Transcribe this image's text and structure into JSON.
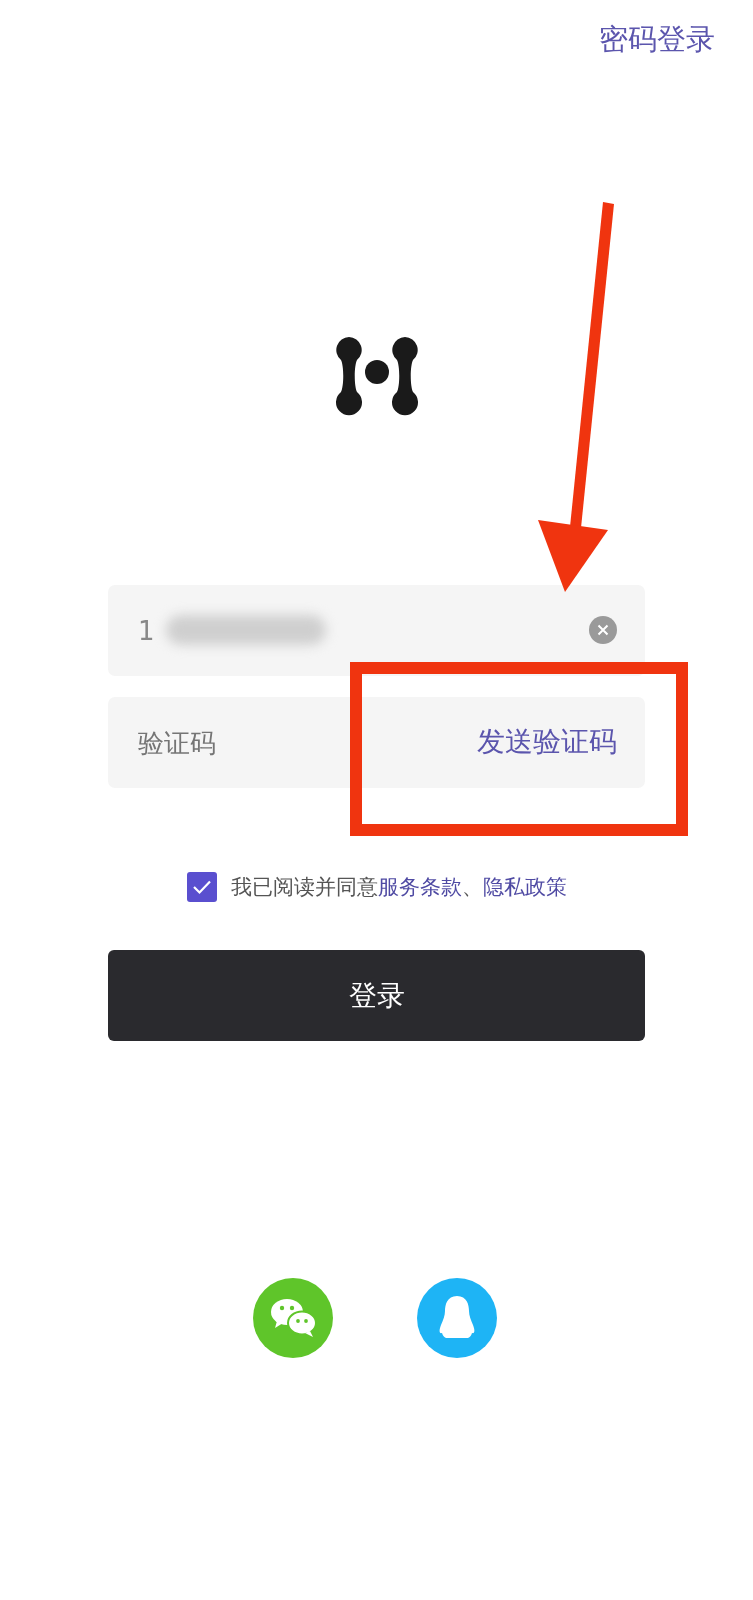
{
  "header": {
    "switch_link": "密码登录"
  },
  "phone_field": {
    "value": "1",
    "redacted": true
  },
  "code_field": {
    "placeholder": "验证码",
    "send_button": "发送验证码"
  },
  "agreement": {
    "checked": true,
    "prefix": "我已阅读并同意",
    "terms_link": "服务条款",
    "separator": "、",
    "privacy_link": "隐私政策"
  },
  "login_button": "登录",
  "social_logins": [
    {
      "kind": "wechat"
    },
    {
      "kind": "qq"
    }
  ]
}
